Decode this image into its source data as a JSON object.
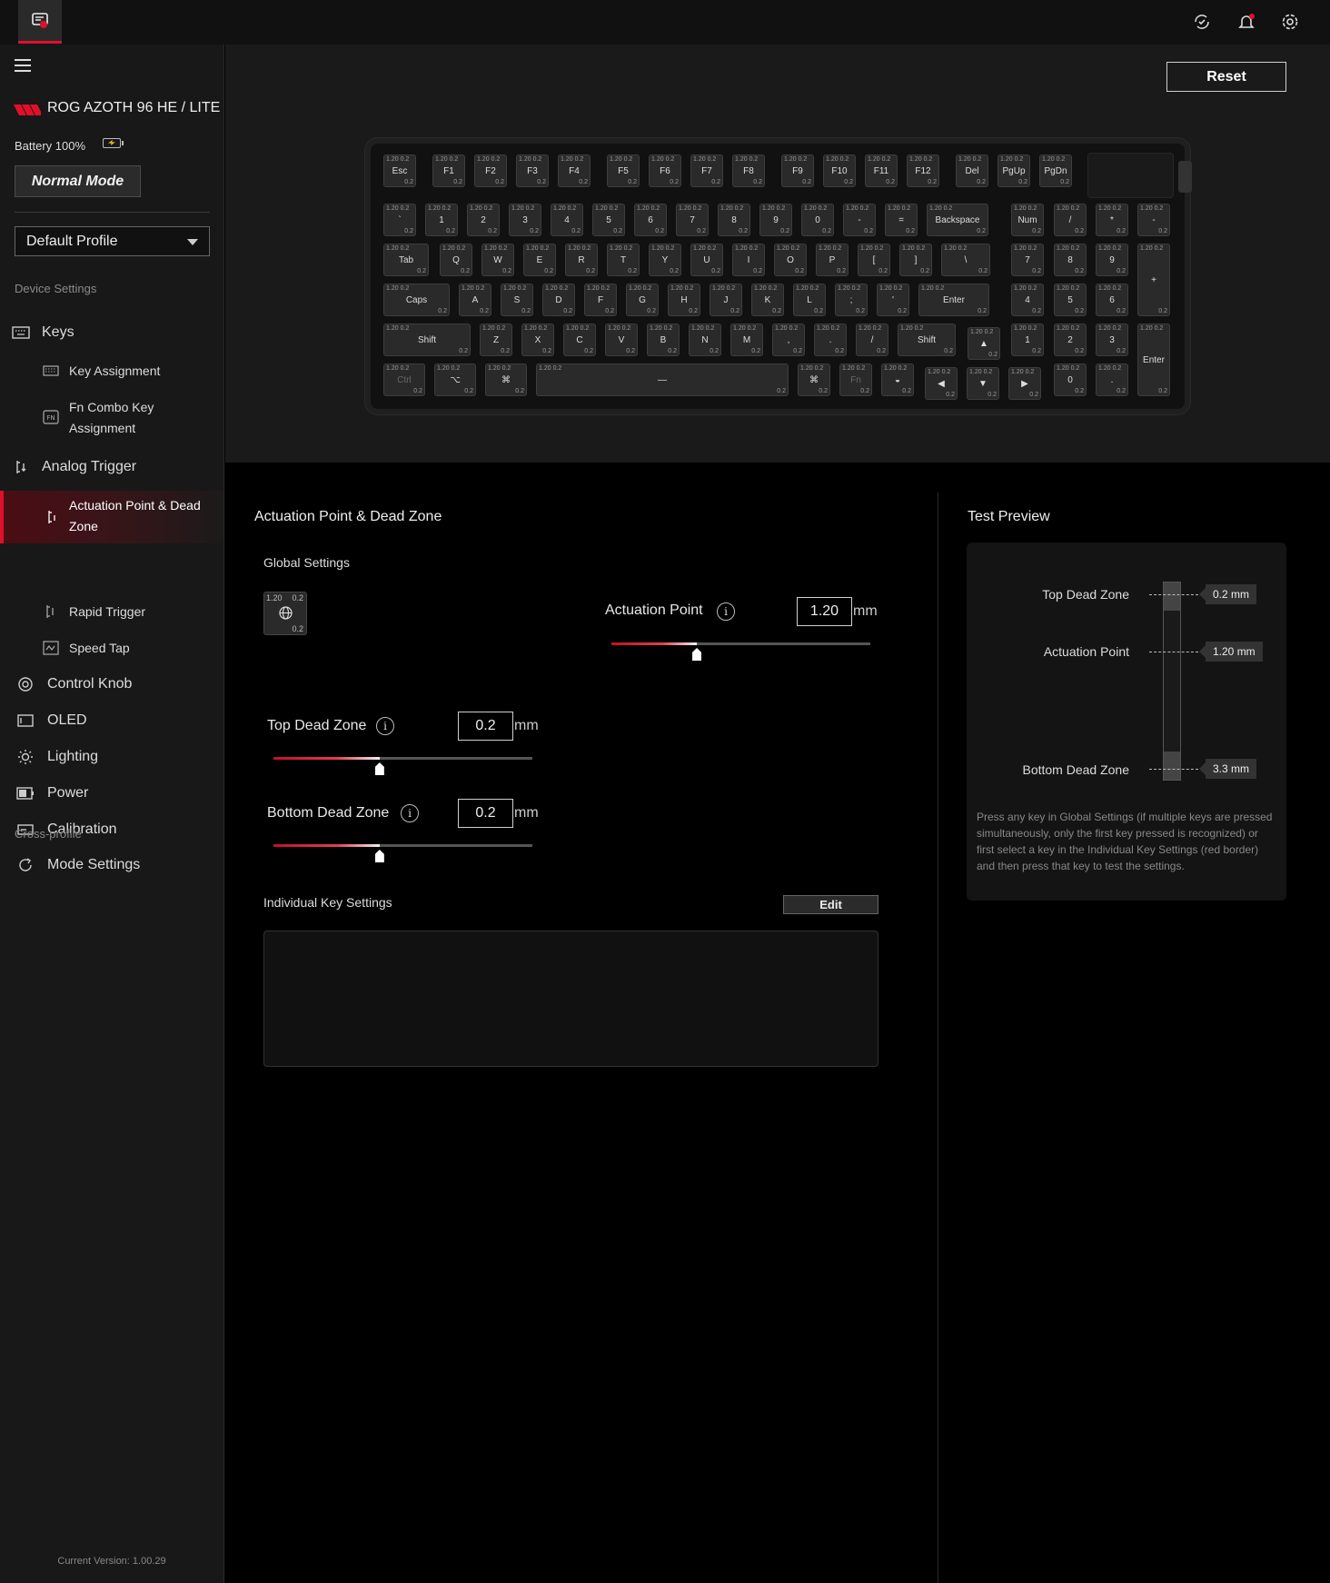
{
  "device": {
    "name": "ROG AZOTH 96 HE / LITE",
    "battery": "Battery 100%",
    "mode": "Normal Mode"
  },
  "profile": {
    "selected": "Default Profile"
  },
  "sidebar": {
    "section_device": "Device Settings",
    "keys": "Keys",
    "key_assignment": "Key Assignment",
    "fn_combo": "Fn Combo Key Assignment",
    "analog_trigger": "Analog Trigger",
    "actuation": "Actuation Point & Dead Zone",
    "rapid_trigger": "Rapid Trigger",
    "speed_tap": "Speed Tap",
    "control_knob": "Control Knob",
    "oled": "OLED",
    "lighting": "Lighting",
    "power": "Power",
    "calibration": "Calibration",
    "section_cross": "Cross-profile",
    "mode_settings": "Mode Settings",
    "version": "Current Version: 1.00.29"
  },
  "toolbar": {
    "reset": "Reset"
  },
  "keyboard": {
    "key_defaults": {
      "actuation": "1.20",
      "deadzone": "0.2"
    },
    "rows": [
      [
        "Esc",
        "F1",
        "F2",
        "F3",
        "F4",
        "F5",
        "F6",
        "F7",
        "F8",
        "F9",
        "F10",
        "F11",
        "F12",
        "Del",
        "PgUp",
        "PgDn"
      ],
      [
        "`",
        "1",
        "2",
        "3",
        "4",
        "5",
        "6",
        "7",
        "8",
        "9",
        "0",
        "-",
        "=",
        "Backspace",
        "Num",
        "/",
        "*",
        "-"
      ],
      [
        "Tab",
        "Q",
        "W",
        "E",
        "R",
        "T",
        "Y",
        "U",
        "I",
        "O",
        "P",
        "[",
        "]",
        "\\",
        "7",
        "8",
        "9",
        "+"
      ],
      [
        "Caps",
        "A",
        "S",
        "D",
        "F",
        "G",
        "H",
        "J",
        "K",
        "L",
        ";",
        "'",
        "Enter",
        "4",
        "5",
        "6"
      ],
      [
        "Shift",
        "Z",
        "X",
        "C",
        "V",
        "B",
        "N",
        "M",
        ",",
        ".",
        "/",
        "Shift",
        "▲",
        "1",
        "2",
        "3",
        "Enter"
      ],
      [
        "Ctrl",
        "⌥",
        "⌘",
        "—",
        "⌘",
        "Fn",
        "◒",
        "◀",
        "▼",
        "▶",
        "0",
        "."
      ]
    ]
  },
  "main": {
    "title": "Actuation Point & Dead Zone",
    "global_settings": "Global Settings",
    "global_key": {
      "actuation": "1.20",
      "deadzone_top": "0.2",
      "deadzone_bottom": "0.2"
    },
    "actuation_point": {
      "label": "Actuation Point",
      "value": "1.20",
      "unit": "mm",
      "fraction": 0.33
    },
    "top_dead_zone": {
      "label": "Top Dead Zone",
      "value": "0.2",
      "unit": "mm",
      "fraction": 0.41
    },
    "bottom_dead_zone": {
      "label": "Bottom Dead Zone",
      "value": "0.2",
      "unit": "mm",
      "fraction": 0.41
    },
    "individual": "Individual Key Settings",
    "edit": "Edit"
  },
  "preview": {
    "title": "Test Preview",
    "top_dead_zone": "Top Dead Zone",
    "top_value": "0.2 mm",
    "actuation_point": "Actuation Point",
    "actuation_value": "1.20 mm",
    "bottom_dead_zone": "Bottom Dead Zone",
    "bottom_value": "3.3 mm",
    "note": "Press any key in Global Settings (if multiple keys are pressed simultaneously, only the first key pressed is recognized) or first select a key in the Individual Key Settings (red border) and then press that key to test the settings."
  },
  "colors": {
    "accent": "#e0102a",
    "bg": "#000000",
    "panel": "#181818"
  },
  "icons": [
    "app-icon",
    "sync-icon",
    "bell-icon",
    "gear-icon",
    "hamburger-icon",
    "rog-logo",
    "battery-icon",
    "keyboard-icon",
    "fn-icon",
    "trigger-icon",
    "knob-icon",
    "oled-icon",
    "lighting-icon",
    "power-icon",
    "calibration-icon",
    "mode-icon",
    "globe-icon",
    "info-icon"
  ]
}
